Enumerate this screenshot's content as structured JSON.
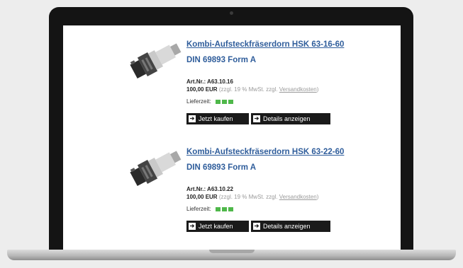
{
  "products": [
    {
      "title": "Kombi-Aufsteckfräserdorn HSK 63-16-60",
      "subtitle": "DIN 69893 Form A",
      "art_nr": "Art.Nr.: A63.10.16",
      "price": "100,00 EUR",
      "tax_note": "(zzgl. 19 % MwSt. zzgl.",
      "shipping_link": "Versandkosten",
      "tax_close": ")",
      "delivery_label": "Lieferzeit:",
      "buy_label": "Jetzt kaufen",
      "details_label": "Details anzeigen"
    },
    {
      "title": "Kombi-Aufsteckfräserdorn HSK 63-22-60",
      "subtitle": "DIN 69893 Form A",
      "art_nr": "Art.Nr.: A63.10.22",
      "price": "100,00 EUR",
      "tax_note": "(zzgl. 19 % MwSt. zzgl.",
      "shipping_link": "Versandkosten",
      "tax_close": ")",
      "delivery_label": "Lieferzeit:",
      "buy_label": "Jetzt kaufen",
      "details_label": "Details anzeigen"
    }
  ],
  "icons": {
    "button_arrow": "arrow-right-icon",
    "stock": "stock-indicator-icon",
    "product_image": "tool-holder-image"
  },
  "colors": {
    "link": "#2f5d9b",
    "stock_green": "#4fb84a",
    "button_bg": "#1a1a1a"
  }
}
